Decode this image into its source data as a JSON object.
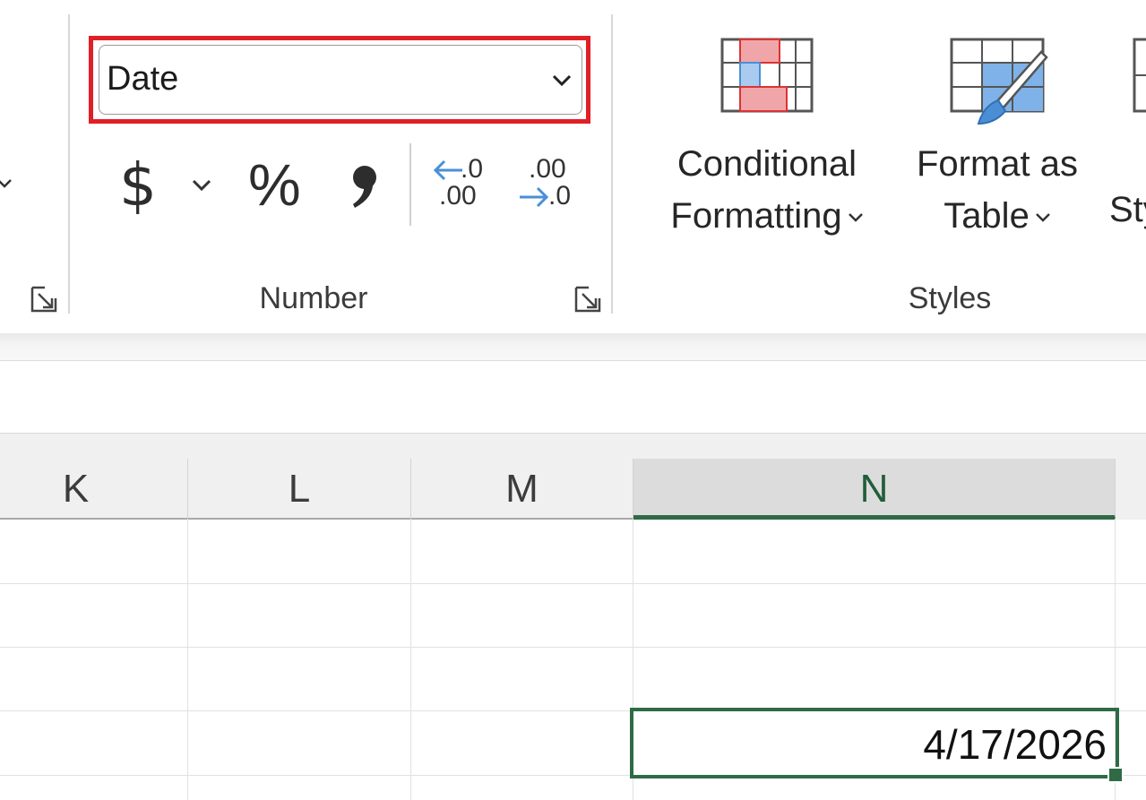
{
  "ribbon": {
    "number_group": {
      "label": "Number",
      "format_select": {
        "value": "Date"
      },
      "currency_symbol": "$",
      "percent_symbol": "%",
      "comma_symbol": "❜",
      "increase_decimal": {
        "top": ".0",
        "bottom": ".00"
      },
      "decrease_decimal": {
        "top": ".00",
        "bottom": ".0"
      }
    },
    "styles_group": {
      "label": "Styles",
      "conditional_formatting": {
        "line1": "Conditional",
        "line2": "Formatting"
      },
      "format_as_table": {
        "line1": "Format as",
        "line2": "Table"
      },
      "cell_styles_partial": "Sty"
    }
  },
  "grid": {
    "columns": [
      "K",
      "L",
      "M",
      "N"
    ],
    "selected_column": "N",
    "active_cell_value": "4/17/2026"
  },
  "colors": {
    "highlight_outline": "#e01f26",
    "selection_green": "#2e6b45",
    "accent_blue": "#4a8fd6"
  }
}
